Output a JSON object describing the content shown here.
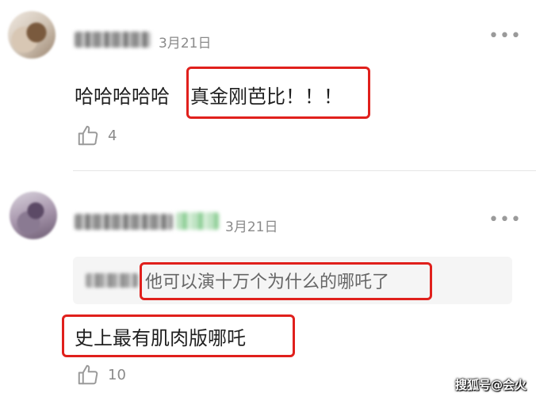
{
  "comments": [
    {
      "date": "3月21日",
      "text_prefix": "哈哈哈哈哈",
      "text_highlight": "真金刚芭比！！！",
      "likes": "4"
    },
    {
      "date": "3月21日",
      "quoted_text": "他可以演十万个为什么的哪吒了",
      "text": "史上最有肌肉版哪吒",
      "likes": "10"
    }
  ],
  "more_icon": "more-dots-icon",
  "like_icon": "thumbs-up-icon",
  "highlight_color": "#e0201c",
  "watermark": "搜狐号@会火"
}
